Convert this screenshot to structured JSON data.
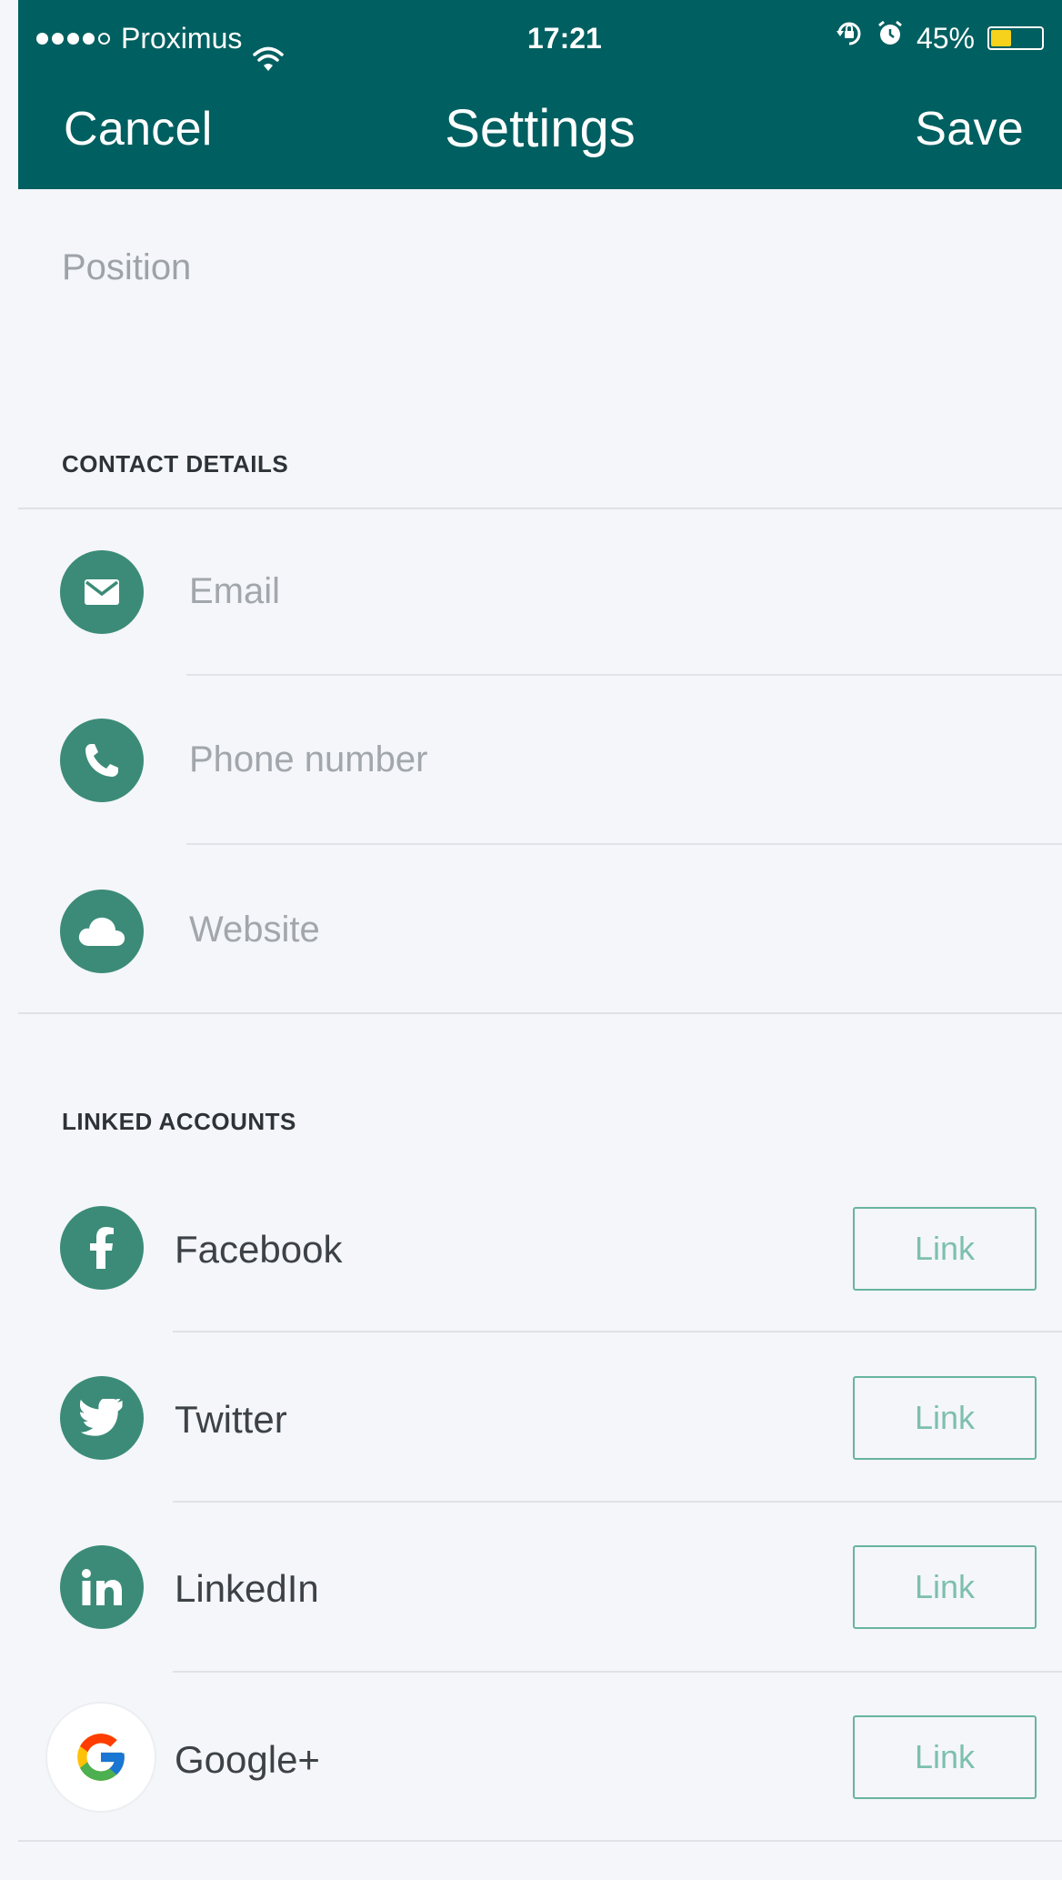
{
  "status_bar": {
    "carrier": "Proximus",
    "time": "17:21",
    "battery_percent": "45%",
    "battery_level": 0.45,
    "icons": [
      "signal-dots",
      "wifi-icon",
      "orientation-lock-icon",
      "alarm-icon",
      "battery-icon"
    ]
  },
  "nav": {
    "cancel_label": "Cancel",
    "title": "Settings",
    "save_label": "Save"
  },
  "profile": {
    "position_placeholder": "Position"
  },
  "contact_details": {
    "header": "CONTACT DETAILS",
    "fields": [
      {
        "placeholder": "Email",
        "icon": "mail-icon"
      },
      {
        "placeholder": "Phone number",
        "icon": "phone-icon"
      },
      {
        "placeholder": "Website",
        "icon": "cloud-icon"
      }
    ]
  },
  "linked_accounts": {
    "header": "LINKED ACCOUNTS",
    "accounts": [
      {
        "name": "Facebook",
        "icon": "facebook-icon",
        "button": "Link"
      },
      {
        "name": "Twitter",
        "icon": "twitter-icon",
        "button": "Link"
      },
      {
        "name": "LinkedIn",
        "icon": "linkedin-icon",
        "button": "Link"
      },
      {
        "name": "Google+",
        "icon": "google-icon",
        "button": "Link"
      }
    ]
  },
  "colors": {
    "header_bg": "#005f60",
    "icon_green": "#3b8b78",
    "link_border": "#68b49f",
    "link_text": "#7dbfae",
    "page_bg": "#f4f6f9",
    "battery_yellow": "#f6d21c"
  }
}
